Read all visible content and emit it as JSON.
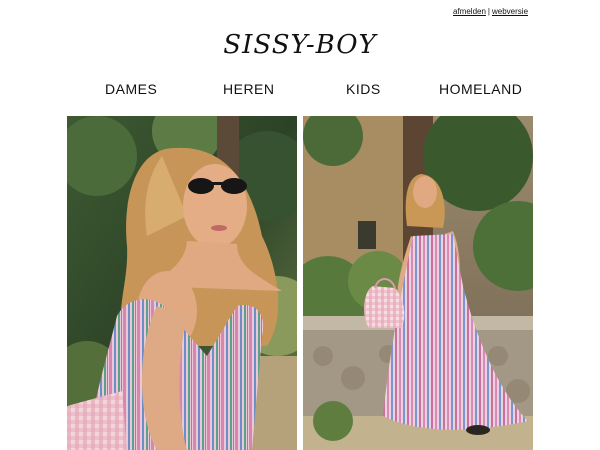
{
  "header": {
    "unsubscribe_label": "afmelden",
    "separator": "|",
    "webversion_label": "webversie",
    "logo_text": "SISSY-BOY"
  },
  "nav": {
    "items": [
      {
        "label": "DAMES"
      },
      {
        "label": "HEREN"
      },
      {
        "label": "KIDS"
      },
      {
        "label": "HOMELAND"
      }
    ]
  },
  "colors": {
    "background": "#ffffff",
    "text": "#111111",
    "foliage_dark": "#2f4a2a",
    "foliage_light": "#6f8f4c",
    "stone_wall": "#a39785",
    "dress_pink": "#d88fb4",
    "dress_blue": "#6f8ec9",
    "hair": "#c89a5e",
    "skin": "#e0a982"
  },
  "images": [
    {
      "name": "woman-sunglasses-striped-dress",
      "subject": "woman with sunglasses in striped summer dress"
    },
    {
      "name": "woman-walking-striped-maxi-dress",
      "subject": "woman walking in striped maxi dress with bag"
    }
  ]
}
